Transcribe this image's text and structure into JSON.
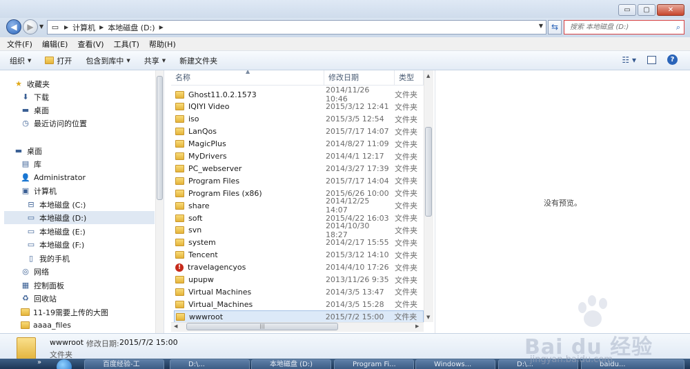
{
  "window": {
    "controls": {
      "minimize": "▭",
      "maximize": "▢",
      "close": "✕"
    }
  },
  "address": {
    "crumbs": [
      "计算机",
      "本地磁盘 (D:)"
    ],
    "search_placeholder": "搜索 本地磁盘 (D:)"
  },
  "menu": [
    "文件(F)",
    "编辑(E)",
    "查看(V)",
    "工具(T)",
    "帮助(H)"
  ],
  "toolbar": {
    "organize": "组织",
    "open": "打开",
    "include_library": "包含到库中",
    "share": "共享",
    "new_folder": "新建文件夹"
  },
  "nav": [
    {
      "label": "收藏夹",
      "icon": "star-icon",
      "indent": 0
    },
    {
      "label": "下载",
      "icon": "download-folder-icon",
      "indent": 1
    },
    {
      "label": "桌面",
      "icon": "desktop-icon",
      "indent": 1
    },
    {
      "label": "最近访问的位置",
      "icon": "recent-places-icon",
      "indent": 1
    },
    {
      "label": "",
      "icon": "",
      "indent": 0
    },
    {
      "label": "桌面",
      "icon": "desktop-icon",
      "indent": 0
    },
    {
      "label": "库",
      "icon": "library-icon",
      "indent": 1
    },
    {
      "label": "Administrator",
      "icon": "user-folder-icon",
      "indent": 1
    },
    {
      "label": "计算机",
      "icon": "computer-icon",
      "indent": 1
    },
    {
      "label": "本地磁盘 (C:)",
      "icon": "system-drive-icon",
      "indent": 2
    },
    {
      "label": "本地磁盘 (D:)",
      "icon": "drive-icon",
      "indent": 2,
      "selected": true
    },
    {
      "label": "本地磁盘 (E:)",
      "icon": "drive-icon",
      "indent": 2
    },
    {
      "label": "本地磁盘 (F:)",
      "icon": "drive-icon",
      "indent": 2
    },
    {
      "label": "我的手机",
      "icon": "phone-icon",
      "indent": 2
    },
    {
      "label": "网络",
      "icon": "network-icon",
      "indent": 1
    },
    {
      "label": "控制面板",
      "icon": "control-panel-icon",
      "indent": 1
    },
    {
      "label": "回收站",
      "icon": "recycle-bin-icon",
      "indent": 1
    },
    {
      "label": "11-19需要上传的大图",
      "icon": "folder-icon",
      "indent": 1
    },
    {
      "label": "aaaa_files",
      "icon": "folder-icon",
      "indent": 1
    }
  ],
  "columns": {
    "name": "名称",
    "date": "修改日期",
    "type": "类型"
  },
  "files": [
    {
      "name": "Ghost11.0.2.1573",
      "date": "2014/11/26 10:46",
      "type": "文件夹"
    },
    {
      "name": "IQIYI Video",
      "date": "2015/3/12 12:41",
      "type": "文件夹"
    },
    {
      "name": "iso",
      "date": "2015/3/5 12:54",
      "type": "文件夹"
    },
    {
      "name": "LanQos",
      "date": "2015/7/17 14:07",
      "type": "文件夹"
    },
    {
      "name": "MagicPlus",
      "date": "2014/8/27 11:09",
      "type": "文件夹"
    },
    {
      "name": "MyDrivers",
      "date": "2014/4/1 12:17",
      "type": "文件夹"
    },
    {
      "name": "PC_webserver",
      "date": "2014/3/27 17:39",
      "type": "文件夹"
    },
    {
      "name": "Program Files",
      "date": "2015/7/17 14:04",
      "type": "文件夹"
    },
    {
      "name": "Program Files (x86)",
      "date": "2015/6/26 10:00",
      "type": "文件夹"
    },
    {
      "name": "share",
      "date": "2014/12/25 14:07",
      "type": "文件夹"
    },
    {
      "name": "soft",
      "date": "2015/4/22 16:03",
      "type": "文件夹"
    },
    {
      "name": "svn",
      "date": "2014/10/30 18:27",
      "type": "文件夹"
    },
    {
      "name": "system",
      "date": "2014/2/17 15:55",
      "type": "文件夹"
    },
    {
      "name": "Tencent",
      "date": "2015/3/12 14:10",
      "type": "文件夹"
    },
    {
      "name": "travelagencyos",
      "date": "2014/4/10 17:26",
      "type": "文件夹",
      "icon": "warning"
    },
    {
      "name": "upupw",
      "date": "2013/11/26 9:35",
      "type": "文件夹"
    },
    {
      "name": "Virtual Machines",
      "date": "2014/3/5 13:47",
      "type": "文件夹"
    },
    {
      "name": "Virtual_Machines",
      "date": "2014/3/5 15:28",
      "type": "文件夹"
    },
    {
      "name": "wwwroot",
      "date": "2015/7/2 15:00",
      "type": "文件夹",
      "selected": true
    }
  ],
  "preview": {
    "message": "没有预览。"
  },
  "details": {
    "name": "wwwroot",
    "modified_label": "修改日期:",
    "modified_value": "2015/7/2 15:00",
    "type": "文件夹"
  },
  "taskbar": {
    "chevron": "»",
    "tasks": [
      "百度经验-工",
      "D:\\...",
      "本地磁盘 (D:)",
      "Program Fi...",
      "Windows...",
      "D:\\...",
      "baidu..."
    ]
  },
  "watermark": {
    "text": "Bai du 经验",
    "sub": "jingyan.baidu.com"
  },
  "colors": {
    "accent": "#2a64b9",
    "selection": "#dce9f8",
    "folder": "#e4b43a"
  }
}
